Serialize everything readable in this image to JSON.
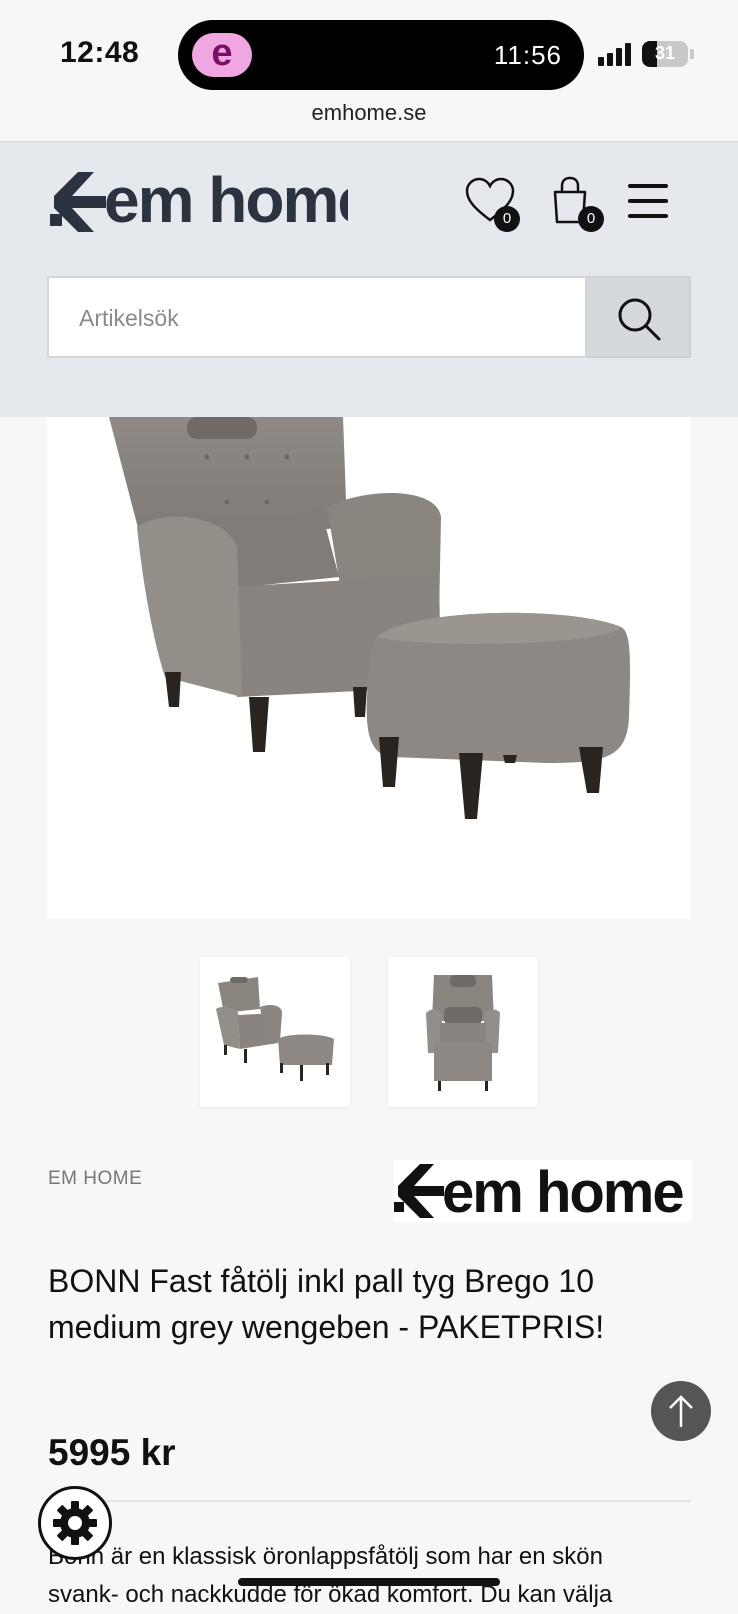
{
  "status_bar": {
    "time": "12:48",
    "island_app_letter": "e",
    "island_time": "11:56",
    "battery": "31"
  },
  "browser": {
    "url": "emhome.se"
  },
  "header": {
    "logo_text": "em home",
    "wishlist_count": "0",
    "cart_count": "0",
    "search_placeholder": "Artikelsök"
  },
  "product": {
    "brand": "EM HOME",
    "brand_logo_text": "em home",
    "title": "BONN Fast fåtölj inkl pall tyg Brego 10 medium grey wengeben - PAKETPRIS!",
    "price": "5995 kr",
    "description_line1": "Bonn är en klassisk öronlappsfåtölj som har en skön",
    "description_line2": "svank- och nackkudde för ökad komfort. Du kan välja"
  },
  "colors": {
    "header_bg": "#e5e8ec",
    "logo_color": "#2c3340",
    "upholstery": "#8b8580",
    "legs": "#2a2420"
  },
  "icons": [
    "heart-icon",
    "shopping-bag-icon",
    "hamburger-menu-icon",
    "search-icon",
    "arrow-up-icon",
    "gear-icon"
  ]
}
